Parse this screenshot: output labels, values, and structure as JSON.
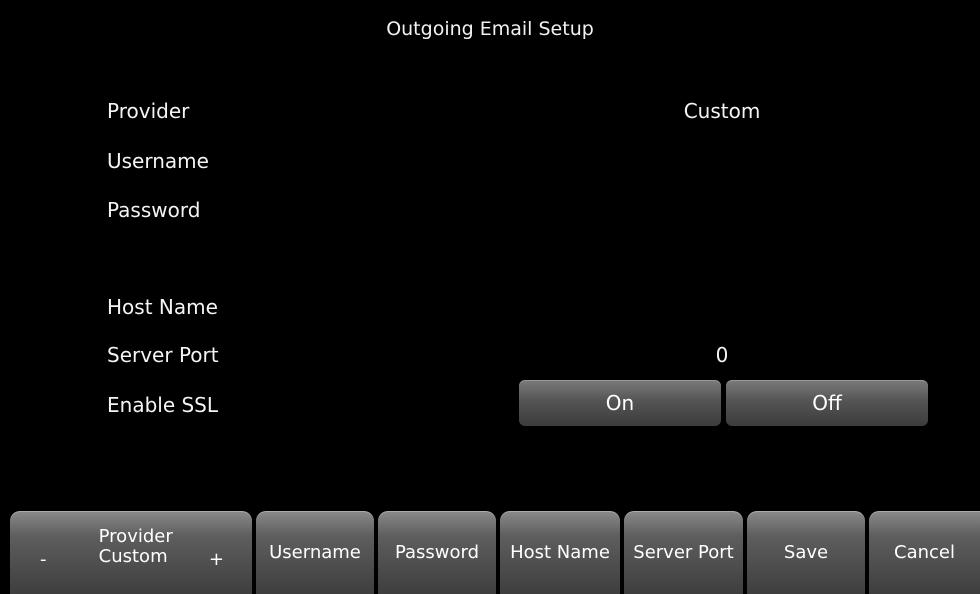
{
  "screen": {
    "title": "Outgoing Email Setup"
  },
  "settings": {
    "provider": {
      "label": "Provider",
      "value": "Custom"
    },
    "username": {
      "label": "Username",
      "value": ""
    },
    "password": {
      "label": "Password",
      "value": ""
    },
    "host_name": {
      "label": "Host Name",
      "value": ""
    },
    "server_port": {
      "label": "Server Port",
      "value": "0"
    },
    "enable_ssl": {
      "label": "Enable SSL",
      "on_label": "On",
      "off_label": "Off"
    }
  },
  "softkeys": {
    "provider": {
      "label": "Provider",
      "value": "Custom",
      "decrement": "-",
      "increment": "+"
    },
    "username": "Username",
    "password": "Password",
    "host_name": "Host Name",
    "server_port": "Server Port",
    "save": "Save",
    "cancel": "Cancel"
  },
  "colors": {
    "background": "#000000",
    "text": "#ffffff",
    "button_gray": "#555555"
  }
}
